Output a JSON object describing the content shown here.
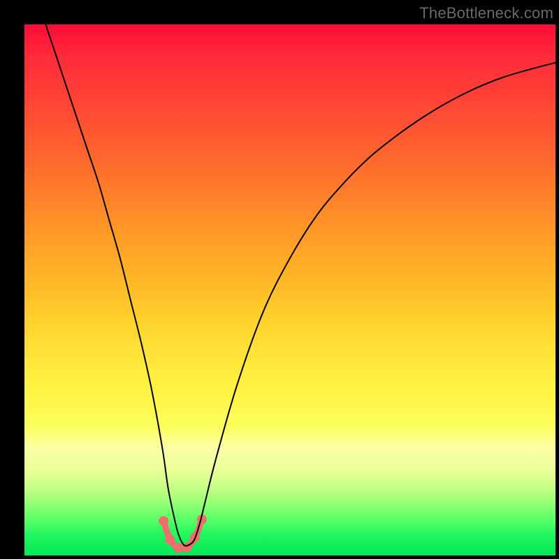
{
  "watermark": "TheBottleneck.com",
  "chart_data": {
    "type": "line",
    "title": "",
    "xlabel": "",
    "ylabel": "",
    "xlim": [
      0,
      100
    ],
    "ylim": [
      0,
      100
    ],
    "series": [
      {
        "name": "bottleneck-curve",
        "x": [
          4,
          6,
          8,
          10,
          12,
          14,
          16,
          18,
          20,
          22,
          24,
          26,
          27,
          28,
          29,
          30,
          31,
          32,
          33,
          34,
          36,
          40,
          45,
          50,
          55,
          60,
          65,
          70,
          75,
          80,
          85,
          90,
          95,
          100
        ],
        "y": [
          100,
          94,
          88,
          82,
          76,
          70,
          63,
          56,
          48,
          40,
          31,
          20,
          13,
          8,
          4,
          2,
          2,
          3,
          6,
          10,
          18,
          32,
          46,
          56,
          64,
          70,
          75,
          79,
          82.5,
          85.5,
          88,
          90,
          91.5,
          92.8
        ],
        "stroke": "#000000",
        "stroke_width": 2
      },
      {
        "name": "bottom-marker-arc",
        "x": [
          26.2,
          27.0,
          27.8,
          28.6,
          29.4,
          30.2,
          31.0,
          31.8,
          32.6,
          33.4
        ],
        "y": [
          6.5,
          4.0,
          2.5,
          1.7,
          1.3,
          1.4,
          1.9,
          2.9,
          4.5,
          6.8
        ],
        "stroke": "#ef6f6f",
        "stroke_width": 9
      }
    ],
    "markers": [
      {
        "x": 26.2,
        "y": 6.5,
        "r": 7,
        "fill": "#ef6f6f"
      },
      {
        "x": 27.4,
        "y": 3.0,
        "r": 7,
        "fill": "#ef6f6f"
      },
      {
        "x": 29.0,
        "y": 1.4,
        "r": 7,
        "fill": "#ef6f6f"
      },
      {
        "x": 30.6,
        "y": 1.5,
        "r": 7,
        "fill": "#ef6f6f"
      },
      {
        "x": 32.1,
        "y": 3.4,
        "r": 7,
        "fill": "#ef6f6f"
      },
      {
        "x": 33.4,
        "y": 6.8,
        "r": 7,
        "fill": "#ef6f6f"
      }
    ],
    "colors": {
      "gradient_top": "#ff0b3a",
      "gradient_bottom": "#00e756",
      "curve": "#000000",
      "markers": "#ef6f6f",
      "frame": "#000000"
    }
  }
}
